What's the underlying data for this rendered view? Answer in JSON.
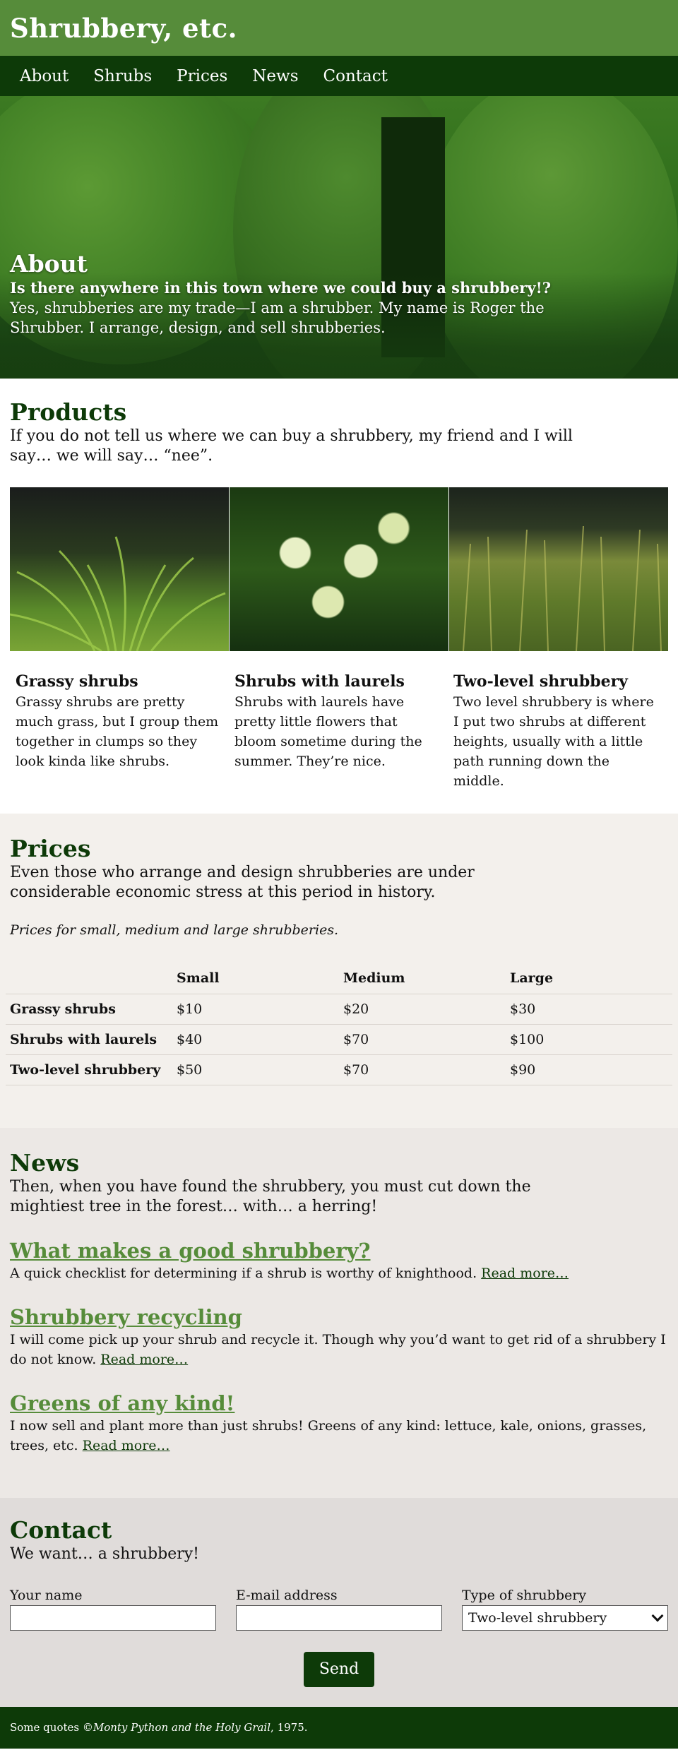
{
  "site": {
    "title": "Shrubbery, etc."
  },
  "nav": [
    "About",
    "Shrubs",
    "Prices",
    "News",
    "Contact"
  ],
  "hero": {
    "heading": "About",
    "question": "Is there anywhere in this town where we could buy a shrubbery!?",
    "text": "Yes, shrubberies are my trade—I am a shrubber. My name is Roger the Shrubber. I arrange, design, and sell shrubberies."
  },
  "products": {
    "heading": "Products",
    "lead": "If you do not tell us where we can buy a shrubbery, my friend and I will say… we will say… “nee”.",
    "items": [
      {
        "title": "Grassy shrubs",
        "text": "Grassy shrubs are pretty much grass, but I group them together in clumps so they look kinda like shrubs."
      },
      {
        "title": "Shrubs with laurels",
        "text": "Shrubs with laurels have pretty little flowers that bloom sometime during the summer. They’re nice."
      },
      {
        "title": "Two-level shrubbery",
        "text": "Two level shrubbery is where I put two shrubs at different heights, usually with a little path running down the middle."
      }
    ]
  },
  "prices": {
    "heading": "Prices",
    "lead": "Even those who arrange and design shrubberies are under considerable economic stress at this period in history.",
    "caption": "Prices for small, medium and large shrubberies.",
    "columns": [
      "",
      "Small",
      "Medium",
      "Large"
    ],
    "rows": [
      {
        "name": "Grassy shrubs",
        "small": "$10",
        "medium": "$20",
        "large": "$30"
      },
      {
        "name": "Shrubs with laurels",
        "small": "$40",
        "medium": "$70",
        "large": "$100"
      },
      {
        "name": "Two-level shrubbery",
        "small": "$50",
        "medium": "$70",
        "large": "$90"
      }
    ]
  },
  "news": {
    "heading": "News",
    "lead": "Then, when you have found the shrubbery, you must cut down the mightiest tree in the forest… with… a herring!",
    "items": [
      {
        "title": "What makes a good shrubbery?",
        "text": "A quick checklist for determining if a shrub is worthy of knighthood.",
        "link": "Read more…"
      },
      {
        "title": "Shrubbery recycling",
        "text": "I will come pick up your shrub and recycle it. Though why you’d want to get rid of a shrubbery I do not know.",
        "link": "Read more…"
      },
      {
        "title": "Greens of any kind!",
        "text": "I now sell and plant more than just shrubs! Greens of any kind: lettuce, kale, onions, grasses, trees, etc.",
        "link": "Read more…"
      }
    ]
  },
  "contact": {
    "heading": "Contact",
    "lead": "We want… a shrubbery!",
    "name_label": "Your name",
    "name_value": "",
    "email_label": "E-mail address",
    "email_value": "",
    "type_label": "Type of shrubbery",
    "type_value": "Two-level shrubbery",
    "send_label": "Send"
  },
  "footer": {
    "prefix": "Some quotes © ",
    "title": "Monty Python and the Holy Grail",
    "suffix": ", 1975."
  },
  "colors": {
    "header_green": "#568c3a",
    "dark_green": "#0d3a08",
    "prices_bg": "#f3f0ec",
    "news_bg": "#ece8e5",
    "contact_bg": "#e0dcda"
  }
}
